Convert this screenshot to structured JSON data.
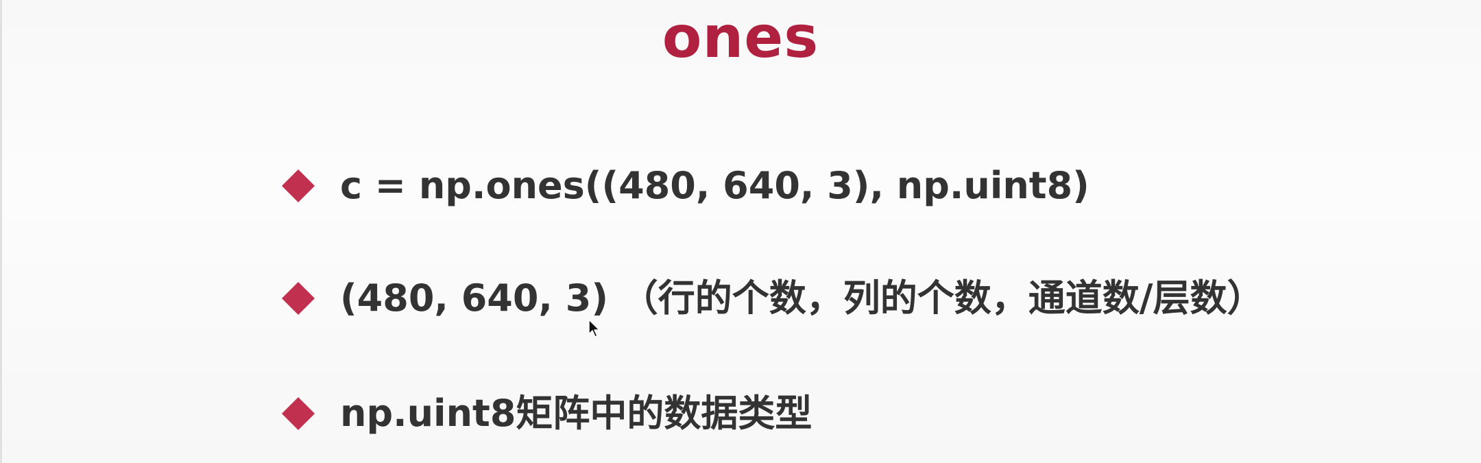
{
  "title": "ones",
  "bullets": [
    {
      "text": "c = np.ones((480, 640, 3), np.uint8)"
    },
    {
      "text": "(480, 640, 3) （行的个数，列的个数，通道数/层数）"
    },
    {
      "text": "np.uint8矩阵中的数据类型"
    }
  ],
  "icons": {
    "bullet": "diamond-bullet-icon",
    "cursor": "mouse-pointer-icon"
  },
  "colors": {
    "title": "#b0203f",
    "bullet": "#c1304f",
    "text": "#333333",
    "background": "#fafafa"
  }
}
